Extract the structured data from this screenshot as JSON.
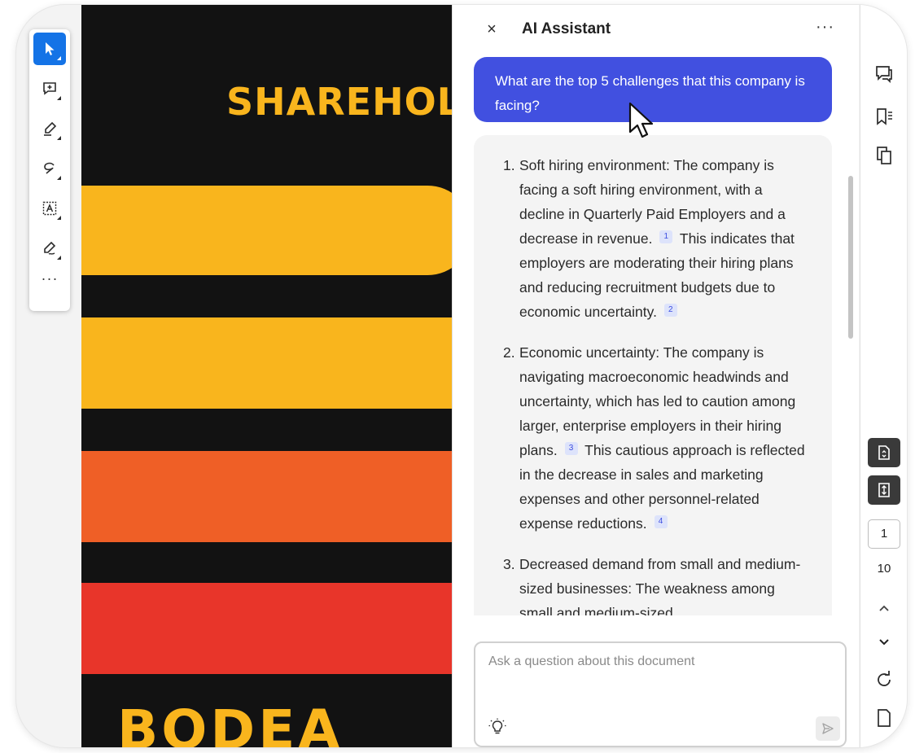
{
  "toolbar": {
    "tools": [
      "select-tool",
      "add-comment-tool",
      "highlight-tool",
      "draw-tool",
      "text-select-tool",
      "sign-tool"
    ],
    "more_label": "···"
  },
  "document": {
    "title_text": "SHAREHOLD",
    "brand_text": "BODEA",
    "colors": {
      "background": "#121212",
      "yellow": "#f9b51d",
      "orange": "#ef5f26",
      "red": "#e8352a"
    }
  },
  "assistant": {
    "close_label": "×",
    "title": "AI Assistant",
    "more_label": "···",
    "question": "What are the top 5 challenges that this company is facing?",
    "answer": [
      {
        "num": "1.",
        "parts": [
          "Soft hiring environment: The company is facing a soft hiring environment, with a decline in Quarterly Paid Employers and a decrease in revenue.",
          "1",
          "This indicates that employers are moderating their hiring plans and reducing recruitment budgets due to economic uncertainty.",
          "2"
        ]
      },
      {
        "num": "2.",
        "parts": [
          "Economic uncertainty: The company is navigating macroeconomic headwinds and uncertainty, which has led to caution among larger, enterprise employers in their hiring plans.",
          "3",
          "This cautious approach is reflected in the decrease in sales and marketing expenses and other personnel-related expense reductions.",
          "4"
        ]
      },
      {
        "num": "3.",
        "parts": [
          "Decreased demand from small and medium-sized businesses: The weakness among small and medium-sized"
        ]
      }
    ],
    "input_placeholder": "Ask a question about this document",
    "accent_color": "#4150e0"
  },
  "pager": {
    "current_page": "1",
    "total_pages": "10"
  }
}
